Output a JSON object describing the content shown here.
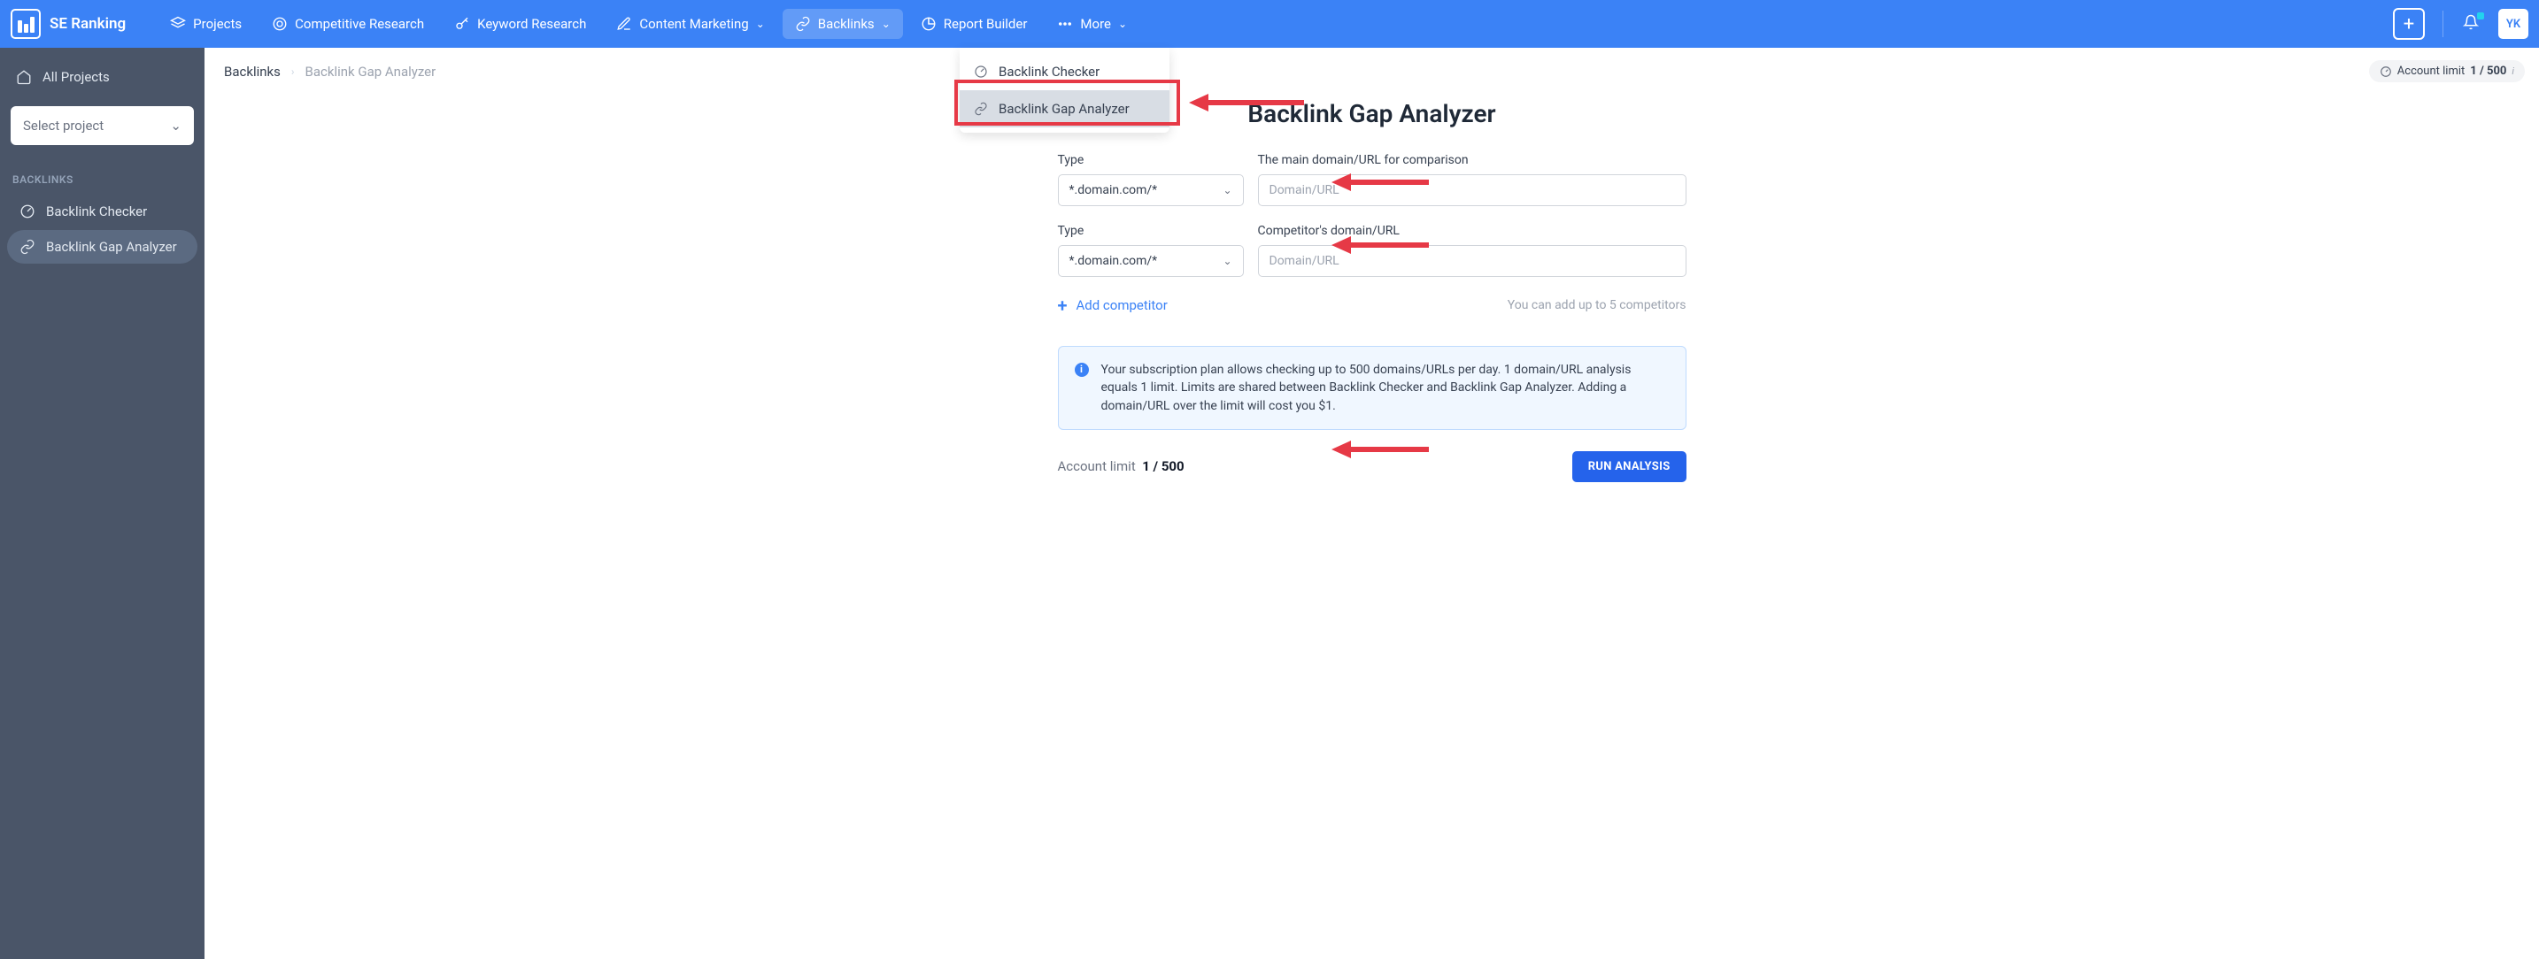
{
  "brand": "SE Ranking",
  "nav": {
    "projects": "Projects",
    "competitive": "Competitive Research",
    "keyword": "Keyword Research",
    "content": "Content Marketing",
    "backlinks": "Backlinks",
    "report": "Report Builder",
    "more": "More"
  },
  "avatar": "YK",
  "sidebar": {
    "all_projects": "All Projects",
    "select_project": "Select project",
    "section": "BACKLINKS",
    "items": [
      {
        "label": "Backlink Checker"
      },
      {
        "label": "Backlink Gap Analyzer"
      }
    ]
  },
  "breadcrumb": {
    "a": "Backlinks",
    "b": "Backlink Gap Analyzer"
  },
  "limit_pill": {
    "label": "Account limit",
    "value": "1 / 500"
  },
  "hero": "Backlink Gap Analyzer",
  "dropdown": {
    "item1": "Backlink Checker",
    "item2": "Backlink Gap Analyzer"
  },
  "form": {
    "type_label": "Type",
    "type_value": "*.domain.com/*",
    "main_label": "The main domain/URL for comparison",
    "placeholder": "Domain/URL",
    "comp_label": "Competitor's domain/URL"
  },
  "add_competitor": "Add competitor",
  "add_note": "You can add up to 5 competitors",
  "info": "Your subscription plan allows checking up to 500 domains/URLs per day. 1 domain/URL analysis equals 1 limit. Limits are shared between Backlink Checker and Backlink Gap Analyzer. Adding a domain/URL over the limit will cost you $1.",
  "footer_limit": {
    "label": "Account limit",
    "value": "1 / 500"
  },
  "run": "RUN ANALYSIS"
}
